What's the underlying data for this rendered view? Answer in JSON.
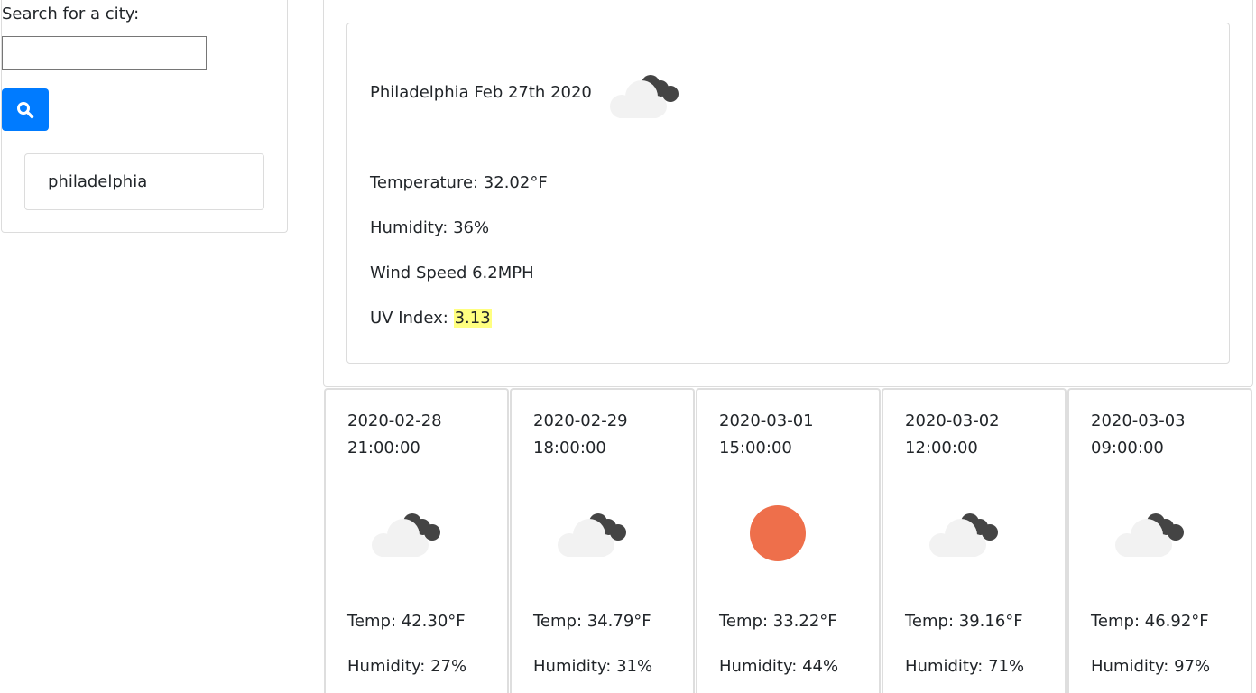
{
  "search": {
    "label": "Search for a city:",
    "input_value": "",
    "placeholder": "",
    "button_icon": "search-icon",
    "button_color": "#007bff"
  },
  "history": [
    {
      "city": "philadelphia"
    }
  ],
  "current": {
    "title": "Philadelphia Feb 27th 2020",
    "icon": "cloudy-night-icon",
    "temperature": "Temperature: 32.02°F",
    "humidity": "Humidity: 36%",
    "wind": "Wind Speed 6.2MPH",
    "uv_label": "UV Index: ",
    "uv_value": "3.13",
    "uv_color": "#ffff80"
  },
  "forecast": [
    {
      "date": "2020-02-28",
      "time": "21:00:00",
      "icon": "cloudy-night-icon",
      "temp": "Temp: 42.30°F",
      "humidity": "Humidity: 27%"
    },
    {
      "date": "2020-02-29",
      "time": "18:00:00",
      "icon": "cloudy-night-icon",
      "temp": "Temp: 34.79°F",
      "humidity": "Humidity: 31%"
    },
    {
      "date": "2020-03-01",
      "time": "15:00:00",
      "icon": "sun-icon",
      "temp": "Temp: 33.22°F",
      "humidity": "Humidity: 44%"
    },
    {
      "date": "2020-03-02",
      "time": "12:00:00",
      "icon": "cloudy-night-icon",
      "temp": "Temp: 39.16°F",
      "humidity": "Humidity: 71%"
    },
    {
      "date": "2020-03-03",
      "time": "09:00:00",
      "icon": "cloudy-night-icon",
      "temp": "Temp: 46.92°F",
      "humidity": "Humidity: 97%"
    }
  ]
}
